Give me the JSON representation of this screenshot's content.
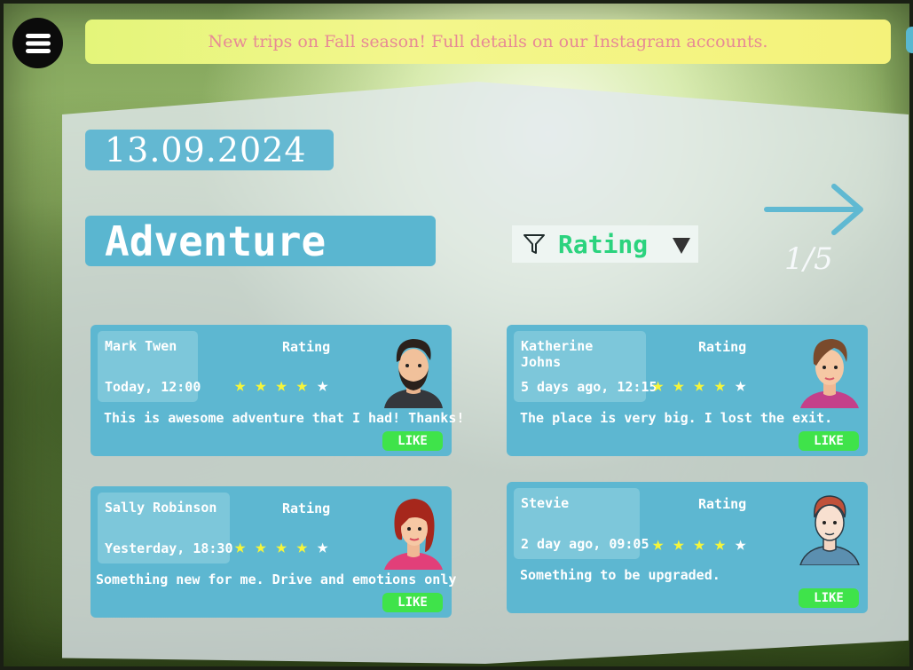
{
  "banner": {
    "text": "New trips on Fall season! Full details on our Instagram accounts."
  },
  "header": {
    "date": "13.09.2024",
    "title": "Adventure"
  },
  "filter": {
    "label": "Rating"
  },
  "pager": {
    "text": "1/5"
  },
  "reviews": [
    {
      "name": "Mark Twen",
      "time": "Today, 12:00",
      "rating_label": "Rating",
      "stars": 4,
      "comment": "This is awesome adventure that I had! Thanks!",
      "like_label": "LIKE"
    },
    {
      "name": "Katherine Johns",
      "time": "5 days ago, 12:15",
      "rating_label": "Rating",
      "stars": 4,
      "comment": "The place is very big. I lost the exit.",
      "like_label": "LIKE"
    },
    {
      "name": "Sally Robinson",
      "time": "Yesterday, 18:30",
      "rating_label": "Rating",
      "stars": 4,
      "comment": "Something new for me. Drive and emotions only",
      "like_label": "LIKE"
    },
    {
      "name": "Stevie",
      "time": "2 day ago, 09:05",
      "rating_label": "Rating",
      "stars": 4,
      "comment": "Something to be upgraded.",
      "like_label": "LIKE"
    }
  ],
  "colors": {
    "accent": "#5ab6d0",
    "banner_text": "#e78a95",
    "like": "#3fe34a",
    "star_on": "#f5f53a",
    "filter_text": "#2bd37e"
  },
  "icons": {
    "menu": "hamburger-icon",
    "filter": "funnel-icon",
    "dropdown": "triangle-down-icon",
    "next": "arrow-right-icon",
    "star": "star-icon"
  }
}
